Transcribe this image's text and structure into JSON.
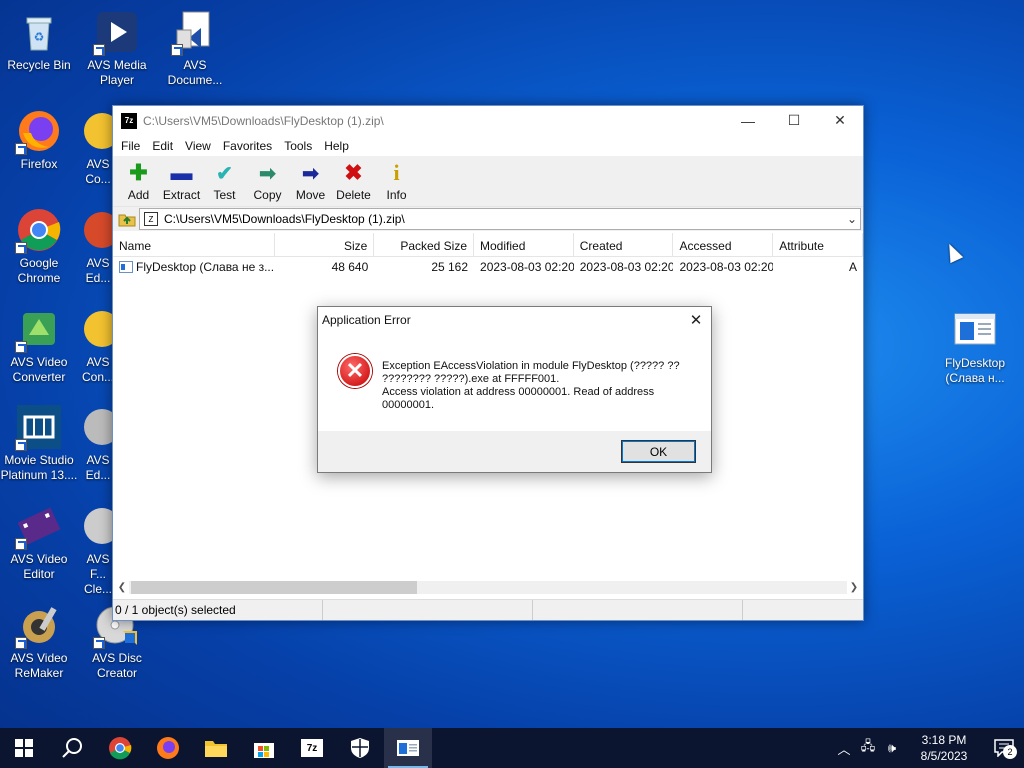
{
  "desktop": {
    "icons_col1": [
      {
        "label": "Recycle Bin",
        "icon": "recycle-bin-icon"
      },
      {
        "label": "Firefox",
        "icon": "firefox-icon"
      },
      {
        "label": "Google Chrome",
        "icon": "chrome-icon"
      },
      {
        "label": "AVS Video Converter",
        "icon": "avs-video-converter-icon"
      },
      {
        "label": "Movie Studio Platinum 13....",
        "icon": "movie-studio-icon"
      },
      {
        "label": "AVS Video Editor",
        "icon": "avs-video-editor-icon"
      },
      {
        "label": "AVS Video ReMaker",
        "icon": "avs-video-remaker-icon"
      }
    ],
    "icons_col2": [
      {
        "label": "AVS Media Player",
        "icon": "avs-media-player-icon"
      },
      {
        "label": "AVS Co...",
        "icon": "avs-icon"
      },
      {
        "label": "AVS Ed...",
        "icon": "avs-icon"
      },
      {
        "label": "AVS Con...",
        "icon": "avs-icon"
      },
      {
        "label": "AVS Ed...",
        "icon": "avs-icon"
      },
      {
        "label": "AVS F... Cle...",
        "icon": "avs-icon"
      },
      {
        "label": "AVS Disc Creator",
        "icon": "avs-disc-creator-icon"
      }
    ],
    "icon_avs_document": {
      "label": "AVS Docume...",
      "icon": "avs-document-icon"
    },
    "icon_flydesktop": {
      "label": "FlyDesktop (Слава н...",
      "icon": "flydesktop-icon"
    }
  },
  "window": {
    "title": "C:\\Users\\VM5\\Downloads\\FlyDesktop (1).zip\\",
    "app_icon_text": "7z",
    "menu": [
      "File",
      "Edit",
      "View",
      "Favorites",
      "Tools",
      "Help"
    ],
    "toolbar": [
      {
        "label": "Add",
        "icon": "add-icon",
        "symbol": "✚",
        "color": "#1a9a1a"
      },
      {
        "label": "Extract",
        "icon": "extract-icon",
        "symbol": "▬",
        "color": "#1a2fa8"
      },
      {
        "label": "Test",
        "icon": "test-icon",
        "symbol": "✔",
        "color": "#2ab3b3"
      },
      {
        "label": "Copy",
        "icon": "copy-icon",
        "symbol": "➡",
        "color": "#2a8a6a"
      },
      {
        "label": "Move",
        "icon": "move-icon",
        "symbol": "➡",
        "color": "#1a2a9a"
      },
      {
        "label": "Delete",
        "icon": "delete-icon",
        "symbol": "✖",
        "color": "#d01010"
      },
      {
        "label": "Info",
        "icon": "info-icon",
        "symbol": "i",
        "color": "#c8a000"
      }
    ],
    "address": "C:\\Users\\VM5\\Downloads\\FlyDesktop (1).zip\\",
    "columns": [
      "Name",
      "Size",
      "Packed Size",
      "Modified",
      "Created",
      "Accessed",
      "Attribute"
    ],
    "rows": [
      {
        "name": "FlyDesktop (Слава не з...",
        "size": "48 640",
        "packed": "25 162",
        "modified": "2023-08-03 02:20",
        "created": "2023-08-03 02:20",
        "accessed": "2023-08-03 02:20",
        "attr": "A"
      }
    ],
    "status": "0 / 1 object(s) selected"
  },
  "dialog": {
    "title": "Application Error",
    "message_line1": "Exception EAccessViolation in module FlyDesktop (????? ?? ???????? ?????).exe at FFFFF001.",
    "message_line2": "Access violation at address 00000001. Read of address 00000001.",
    "ok_label": "OK"
  },
  "taskbar": {
    "time": "3:18 PM",
    "date": "8/5/2023",
    "notification_count": "2",
    "accent": "#76b9ed"
  }
}
